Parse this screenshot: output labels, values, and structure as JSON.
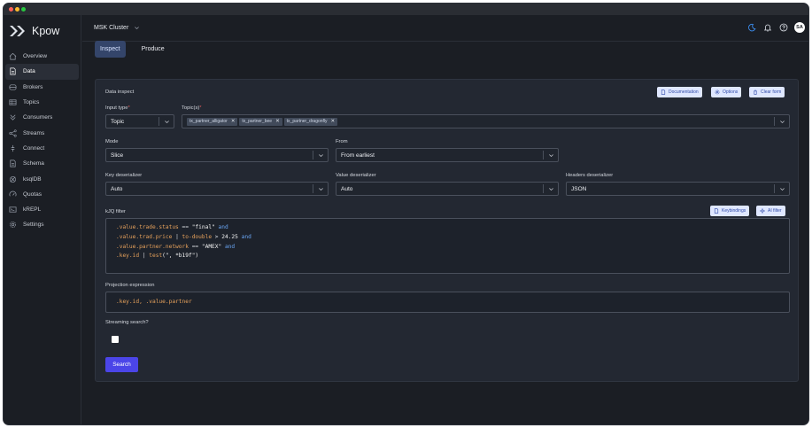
{
  "app": {
    "name": "Kpow"
  },
  "sidebar": {
    "items": [
      {
        "label": "Overview",
        "icon": "home-icon"
      },
      {
        "label": "Data",
        "icon": "document-icon",
        "active": true
      },
      {
        "label": "Brokers",
        "icon": "broker-icon"
      },
      {
        "label": "Topics",
        "icon": "table-icon"
      },
      {
        "label": "Consumers",
        "icon": "chevrons-icon"
      },
      {
        "label": "Streams",
        "icon": "share-icon"
      },
      {
        "label": "Connect",
        "icon": "connect-icon"
      },
      {
        "label": "Schema",
        "icon": "schema-icon"
      },
      {
        "label": "ksqlDB",
        "icon": "ksql-icon"
      },
      {
        "label": "Quotas",
        "icon": "quota-icon"
      },
      {
        "label": "kREPL",
        "icon": "terminal-icon"
      },
      {
        "label": "Settings",
        "icon": "gear-icon"
      }
    ]
  },
  "topbar": {
    "cluster": "MSK Cluster",
    "avatar": "SA"
  },
  "tabs": [
    {
      "label": "Inspect",
      "active": true
    },
    {
      "label": "Produce",
      "active": false
    }
  ],
  "panel": {
    "title": "Data inspect",
    "buttons": {
      "documentation": "Documentation",
      "options": "Options",
      "clear": "Clear form"
    },
    "input_type": {
      "label": "Input type",
      "value": "Topic"
    },
    "topics": {
      "label": "Topic(s)",
      "chips": [
        "tx_partner_alligator",
        "tx_partner_bee",
        "tx_partner_dragonfly"
      ]
    },
    "mode": {
      "label": "Mode",
      "value": "Slice"
    },
    "from": {
      "label": "From",
      "value": "From earliest"
    },
    "key_deserializer": {
      "label": "Key deserializer",
      "value": "Auto"
    },
    "value_deserializer": {
      "label": "Value deserializer",
      "value": "Auto"
    },
    "headers_deserializer": {
      "label": "Headers deserializer",
      "value": "JSON"
    },
    "kjq": {
      "label": "kJQ filter",
      "keybindings": "Keybindings",
      "ai_filter": "AI filter",
      "lines": [
        {
          "path": ".value.trade.status",
          "op": " == ",
          "lit": "\"final\"",
          "tail": " and"
        },
        {
          "path": ".value.trad.price",
          "op": " | ",
          "fn": "to-double",
          "op2": " > ",
          "lit": "24.25",
          "tail": " and"
        },
        {
          "path": ".value.partner.network",
          "op": " == ",
          "lit": "\"AMEX\"",
          "tail": " and"
        },
        {
          "path": ".key.id",
          "op": " | ",
          "fn": "test",
          "lit": "(\", *b19f\")",
          "tail": ""
        }
      ]
    },
    "projection": {
      "label": "Projection expression",
      "value": ".key.id, .value.partner"
    },
    "streaming": {
      "label": "Streaming search?"
    },
    "search_label": "Search"
  },
  "colors": {
    "accent": "#4b45e8",
    "tab_active": "#34456a",
    "panel": "#232832",
    "code_keyword": "#e6a15b",
    "code_and": "#69a5f3"
  }
}
